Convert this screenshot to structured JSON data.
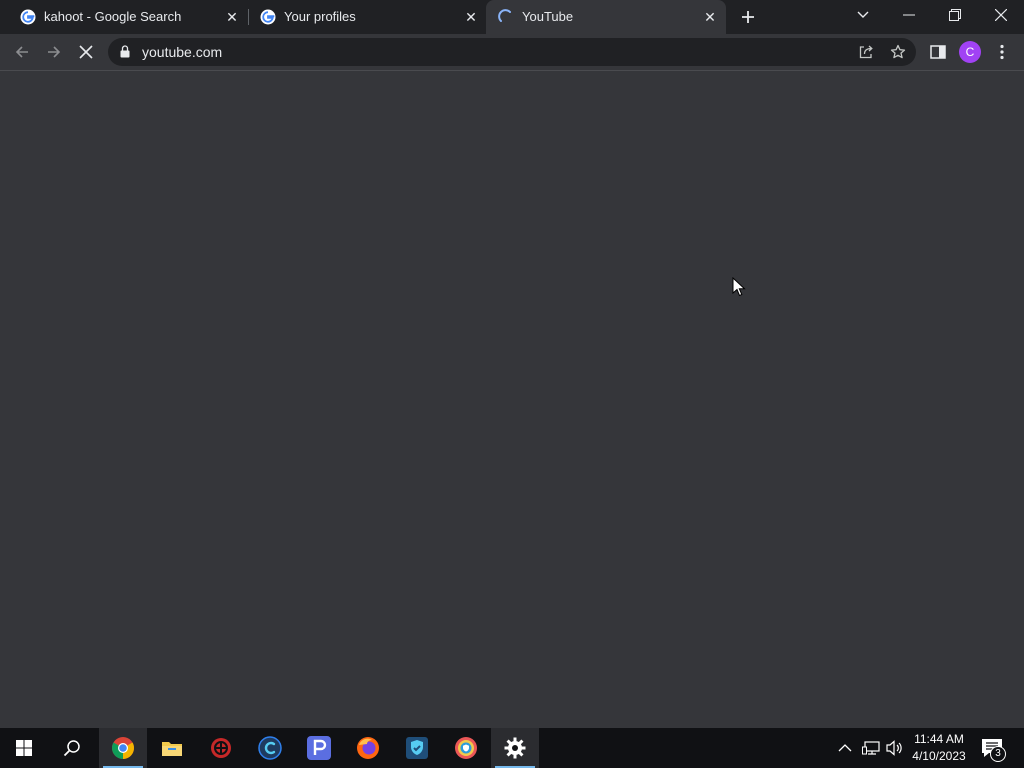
{
  "browser": {
    "tabs": [
      {
        "title": "kahoot - Google Search",
        "active": false,
        "favicon": "google-icon"
      },
      {
        "title": "Your profiles",
        "active": false,
        "favicon": "google-icon"
      },
      {
        "title": "YouTube",
        "active": true,
        "favicon": "loading-spinner-icon"
      }
    ],
    "address": {
      "url": "youtube.com"
    },
    "profile_initial": "C"
  },
  "taskbar": {
    "apps": [
      "start-icon",
      "search-icon",
      "chrome-icon",
      "file-explorer-icon",
      "app-icon",
      "ccleaner-icon",
      "p-app-icon",
      "firefox-icon",
      "shield-app-icon",
      "vpn-icon",
      "settings-icon"
    ],
    "time": "11:44 AM",
    "date": "4/10/2023",
    "notification_count": "3"
  },
  "colors": {
    "accent": "#a142f4",
    "page_bg": "#35363a",
    "tabstrip_bg": "#202124"
  }
}
